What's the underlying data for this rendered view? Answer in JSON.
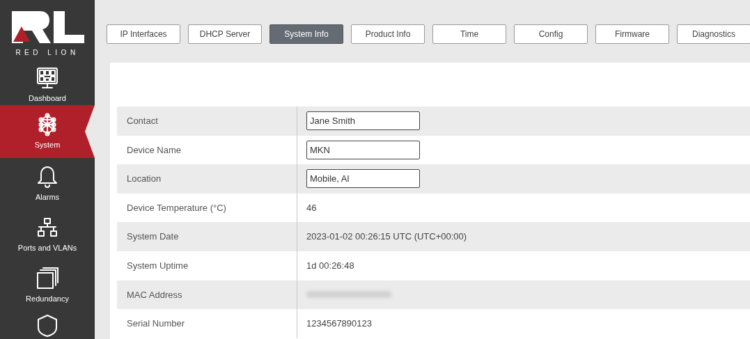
{
  "logo": {
    "text": "RED LION"
  },
  "sidebar": {
    "items": [
      {
        "label": "Dashboard",
        "selected": false
      },
      {
        "label": "System",
        "selected": true
      },
      {
        "label": "Alarms",
        "selected": false
      },
      {
        "label": "Ports and VLANs",
        "selected": false
      },
      {
        "label": "Redundancy",
        "selected": false
      },
      {
        "selected": false
      }
    ]
  },
  "tabs": [
    {
      "label": "IP Interfaces",
      "selected": false
    },
    {
      "label": "DHCP Server",
      "selected": false
    },
    {
      "label": "System Info",
      "selected": true
    },
    {
      "label": "Product Info",
      "selected": false
    },
    {
      "label": "Time",
      "selected": false
    },
    {
      "label": "Config",
      "selected": false
    },
    {
      "label": "Firmware",
      "selected": false
    },
    {
      "label": "Diagnostics",
      "selected": false
    }
  ],
  "table": {
    "rows": [
      {
        "label": "Contact",
        "kind": "input",
        "value": "Jane Smith"
      },
      {
        "label": "Device Name",
        "kind": "input",
        "value": "MKN"
      },
      {
        "label": "Location",
        "kind": "input",
        "value": "Mobile, Al"
      },
      {
        "label": "Device Temperature (°C)",
        "kind": "text",
        "value": "46"
      },
      {
        "label": "System Date",
        "kind": "text",
        "value": "2023-01-02 00:26:15 UTC (UTC+00:00)"
      },
      {
        "label": "System Uptime",
        "kind": "text",
        "value": "1d 00:26:48"
      },
      {
        "label": "MAC Address",
        "kind": "redacted"
      },
      {
        "label": "Serial Number",
        "kind": "text",
        "value": "1234567890123"
      }
    ]
  }
}
